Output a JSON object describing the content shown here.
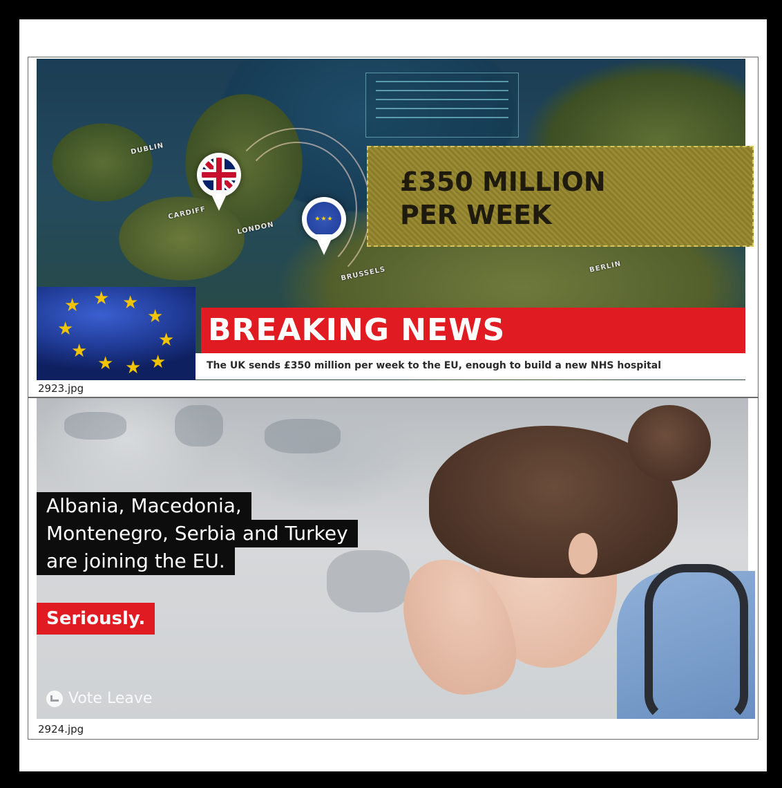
{
  "top_image": {
    "headline_line1": "£350 MILLION",
    "headline_line2": "PER WEEK",
    "banner": "BREAKING NEWS",
    "ticker": "The UK sends £350 million per week to the EU, enough to build a new NHS hospital",
    "map_labels": {
      "cardiff": "CARDIFF",
      "london": "LONDON",
      "brussels": "BRUSSELS",
      "berlin": "BERLIN",
      "dublin": "DUBLIN"
    },
    "caption": "2923.jpg"
  },
  "bottom_image": {
    "line1": "Albania, Macedonia,",
    "line2": "Montenegro, Serbia and Turkey",
    "line3": "are joining the EU.",
    "emphasis": "Seriously.",
    "brand": "Vote Leave",
    "caption": "2924.jpg"
  },
  "colors": {
    "frame": "#000000",
    "breaking_red": "#e01b22",
    "headline_gold": "#9a8c34",
    "text_block": "#0d0d0d"
  }
}
